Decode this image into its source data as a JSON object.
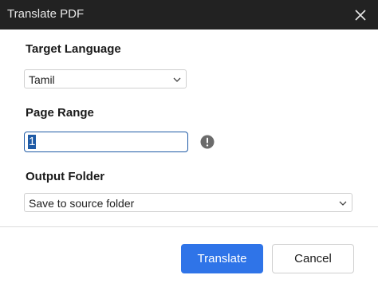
{
  "window": {
    "title": "Translate PDF",
    "close_icon": "close-icon"
  },
  "target_language": {
    "label": "Target Language",
    "selected": "Tamil"
  },
  "page_range": {
    "label": "Page Range",
    "value": "1",
    "info_icon": "info-icon"
  },
  "output_folder": {
    "label": "Output Folder",
    "selected": "Save to source folder"
  },
  "actions": {
    "translate_label": "Translate",
    "cancel_label": "Cancel"
  },
  "colors": {
    "titlebar": "#222222",
    "primary": "#2f74e8",
    "focus": "#1f5ba6"
  }
}
